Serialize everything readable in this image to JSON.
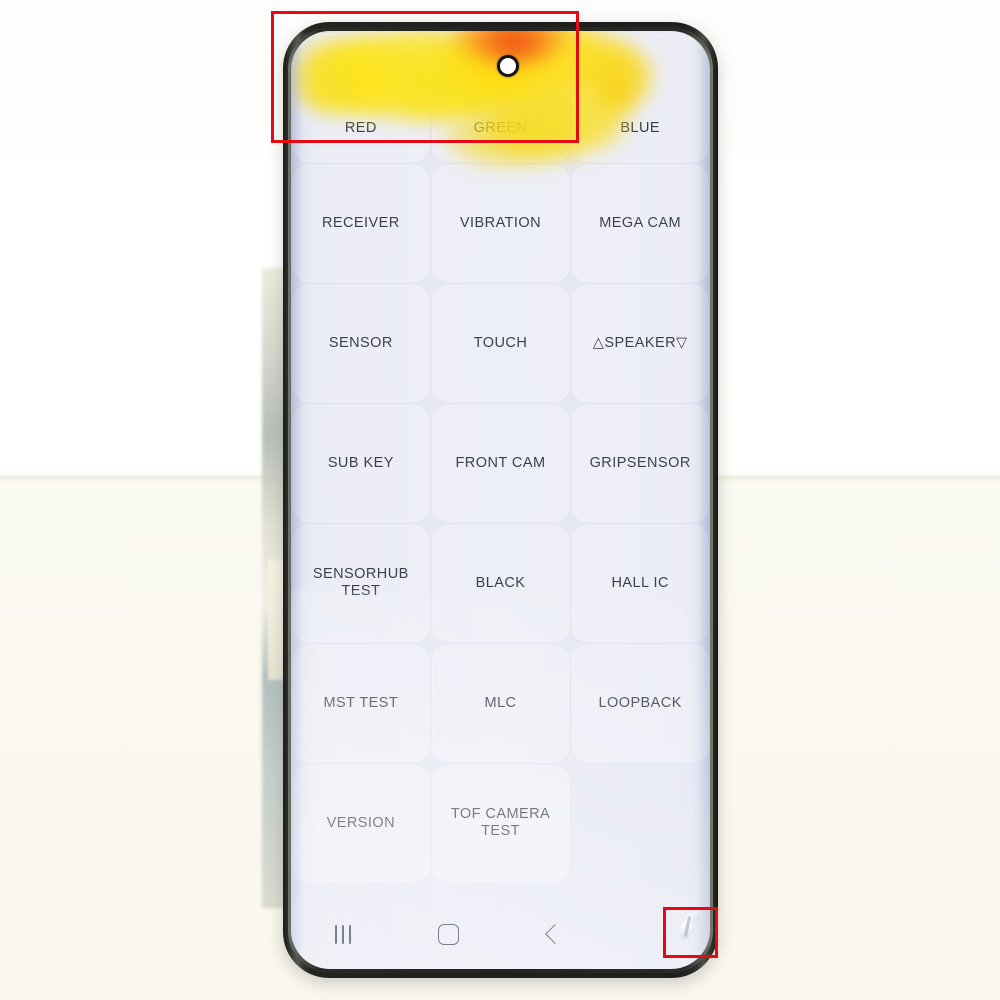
{
  "scene": {
    "subject": "smartphone-display-test-screen",
    "background_upper_color": "#ffffff",
    "background_lower_color": "#faf8ef",
    "phone_body_color": "#1f201d",
    "screen_tint_color": "#e4e6f2"
  },
  "phone": {
    "camera": {
      "name": "punch-hole-camera"
    },
    "defect": {
      "name": "yellow-orange-display-stain",
      "colors": [
        "#fade18",
        "#fa6e19",
        "#ee3e14"
      ],
      "region": "top-row RED and GREEN buttons"
    },
    "corner_defect": {
      "name": "bottom-right-corner-chip",
      "colors": [
        "#ffffff",
        "#c9cede"
      ]
    }
  },
  "screen": {
    "title": "",
    "grid": {
      "columns": 3,
      "rows": [
        [
          {
            "label": "RED",
            "id": "red"
          },
          {
            "label": "GREEN",
            "id": "green"
          },
          {
            "label": "BLUE",
            "id": "blue"
          }
        ],
        [
          {
            "label": "RECEIVER",
            "id": "receiver"
          },
          {
            "label": "VIBRATION",
            "id": "vibration"
          },
          {
            "label": "MEGA CAM",
            "id": "mega-cam"
          }
        ],
        [
          {
            "label": "SENSOR",
            "id": "sensor"
          },
          {
            "label": "TOUCH",
            "id": "touch"
          },
          {
            "label": "△SPEAKER▽",
            "id": "speaker"
          }
        ],
        [
          {
            "label": "SUB KEY",
            "id": "sub-key"
          },
          {
            "label": "FRONT CAM",
            "id": "front-cam"
          },
          {
            "label": "GRIPSENSOR",
            "id": "gripsensor"
          }
        ],
        [
          {
            "label": "SENSORHUB TEST",
            "id": "sensorhub-test"
          },
          {
            "label": "BLACK",
            "id": "black"
          },
          {
            "label": "HALL IC",
            "id": "hall-ic"
          }
        ],
        [
          {
            "label": "MST TEST",
            "id": "mst-test"
          },
          {
            "label": "MLC",
            "id": "mlc"
          },
          {
            "label": "LOOPBACK",
            "id": "loopback"
          }
        ],
        [
          {
            "label": "VERSION",
            "id": "version"
          },
          {
            "label": "TOF CAMERA TEST",
            "id": "tof-camera-test"
          },
          {
            "label": "",
            "id": "empty"
          }
        ]
      ]
    }
  },
  "navbar": {
    "buttons": [
      {
        "id": "recents",
        "icon": "recents-icon"
      },
      {
        "id": "home",
        "icon": "home-icon"
      },
      {
        "id": "back",
        "icon": "back-chevron-icon"
      }
    ]
  },
  "annotations": [
    {
      "id": "anno-top",
      "name": "defect-highlight-top",
      "color": "#e50914"
    },
    {
      "id": "anno-bottom",
      "name": "defect-highlight-bottom-right",
      "color": "#e50914"
    }
  ]
}
